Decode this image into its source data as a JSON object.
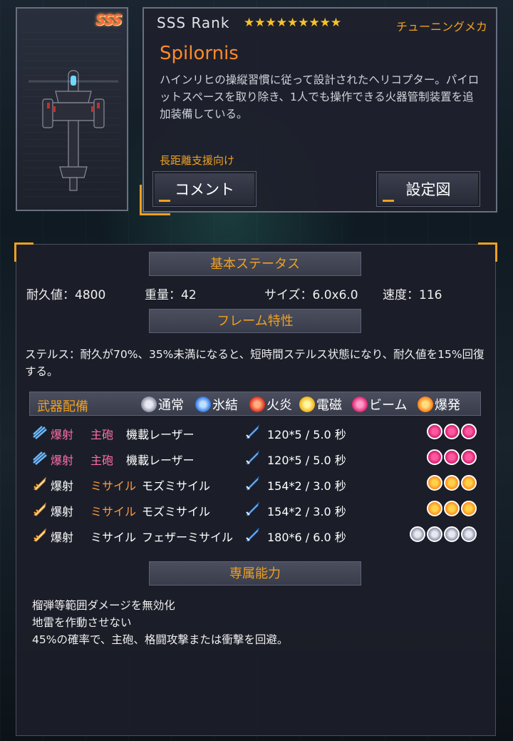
{
  "card": {
    "rank_badge": "SSS"
  },
  "info": {
    "rank_label": "SSS Rank",
    "stars": "★★★★★★★★★",
    "category": "チューニングメカ",
    "name": "Spilornis",
    "description": "ハインリヒの操縦習慣に従って設計されたヘリコプター。パイロットスペースを取り除き、1人でも操作できる火器管制装置を追加装備している。",
    "role": "長距離支援向け",
    "comment_button": "コメント",
    "diagram_button": "設定図"
  },
  "basic": {
    "title": "基本ステータス",
    "durability": "耐久値：4800",
    "weight": "重量：42",
    "size": "サイズ：6.0x6.0",
    "speed": "速度：116"
  },
  "frame": {
    "title": "フレーム特性",
    "text": "ステルス：耐久が70%、35%未満になると、短時間ステルス状態になり、耐久値を15%回復する。"
  },
  "weapons": {
    "title": "武器配備",
    "elements": [
      {
        "label": "通常",
        "color": "#9aa0b8"
      },
      {
        "label": "氷結",
        "color": "#3a8cff"
      },
      {
        "label": "火炎",
        "color": "#ff3a2a"
      },
      {
        "label": "電磁",
        "color": "#ffcc22"
      },
      {
        "label": "ビーム",
        "color": "#ff3a8a"
      },
      {
        "label": "爆発",
        "color": "#ff8a1a"
      }
    ],
    "rows": [
      {
        "action": "爆射",
        "cls": "主砲",
        "name": "機載レーザー",
        "damage": "120*5 / 5.0 秒",
        "dot_type": "beam",
        "dots": 3
      },
      {
        "action": "爆射",
        "cls": "主砲",
        "name": "機載レーザー",
        "damage": "120*5 / 5.0 秒",
        "dot_type": "beam",
        "dots": 3
      },
      {
        "action": "爆射",
        "cls": "ミサイル",
        "name": "モズミサイル",
        "damage": "154*2 / 3.0 秒",
        "dot_type": "blast",
        "dots": 3
      },
      {
        "action": "爆射",
        "cls": "ミサイル",
        "name": "モズミサイル",
        "damage": "154*2 / 3.0 秒",
        "dot_type": "blast",
        "dots": 3
      },
      {
        "action": "爆射",
        "cls": "ミサイル",
        "name": "フェザーミサイル",
        "damage": "180*6 / 6.0 秒",
        "dot_type": "normal",
        "dots": 4
      }
    ]
  },
  "exclusive": {
    "title": "専属能力",
    "lines": [
      "榴弾等範囲ダメージを無効化",
      "地雷を作動させない",
      "45%の確率で、主砲、格闘攻撃または衝撃を回避。"
    ]
  }
}
